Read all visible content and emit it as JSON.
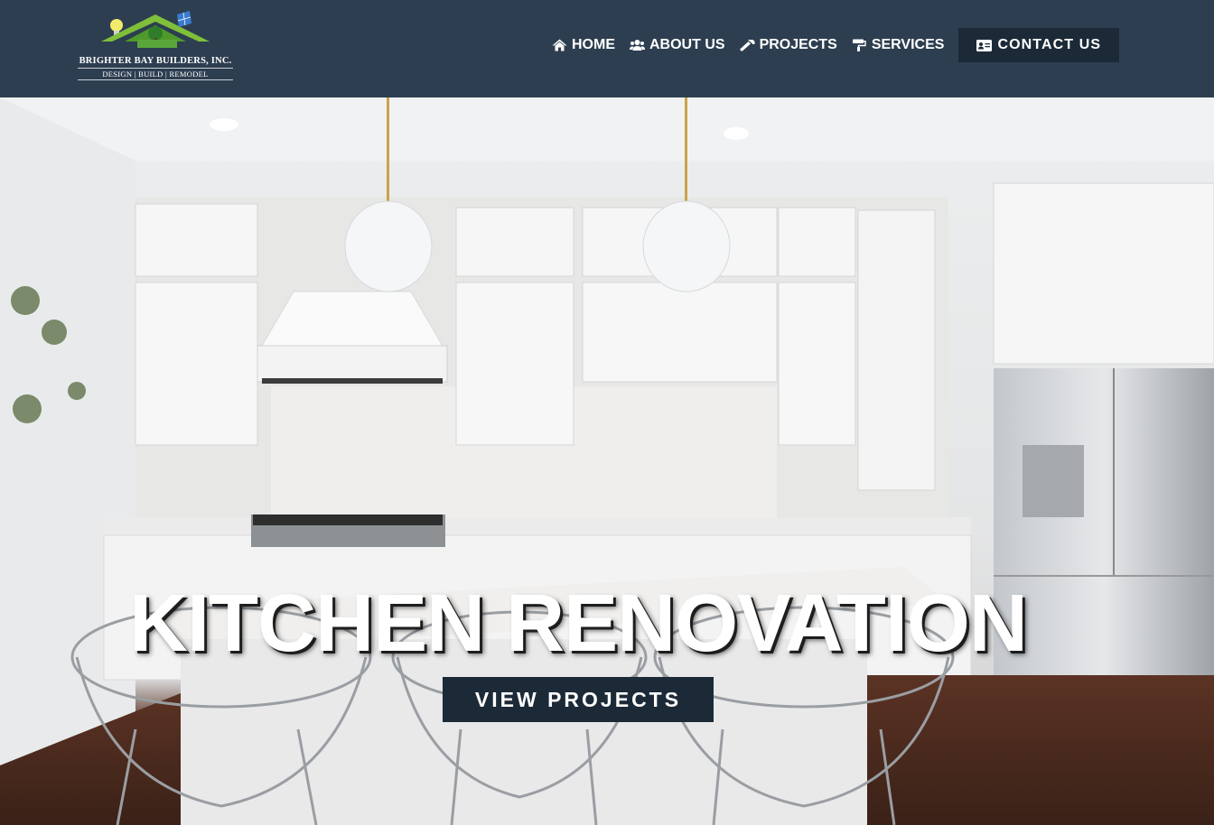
{
  "logo": {
    "name": "BRIGHTER BAY BUILDERS, INC.",
    "tagline": "DESIGN | BUILD | REMODEL"
  },
  "nav": {
    "items": [
      {
        "label": "HOME",
        "icon": "home-icon"
      },
      {
        "label": "ABOUT US",
        "icon": "users-icon"
      },
      {
        "label": "PROJECTS",
        "icon": "hammer-icon"
      },
      {
        "label": "SERVICES",
        "icon": "paint-roller-icon"
      }
    ],
    "cta": {
      "label": "CONTACT US",
      "icon": "contact-card-icon"
    }
  },
  "hero": {
    "title": "KITCHEN RENOVATION",
    "button": "VIEW PROJECTS"
  },
  "colors": {
    "header_bg": "#2d3e50",
    "button_bg": "#1c2a38",
    "text": "#ffffff"
  }
}
